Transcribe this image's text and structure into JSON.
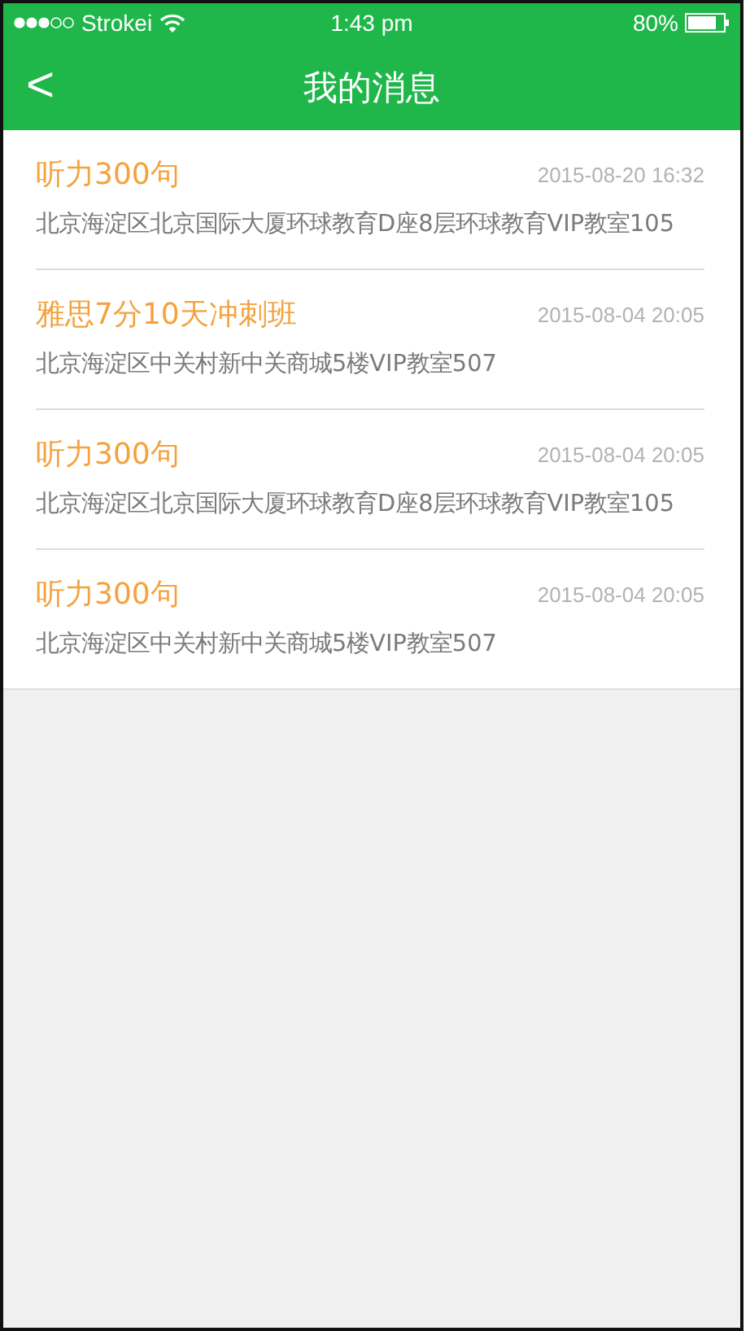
{
  "status_bar": {
    "carrier": "Strokei",
    "time": "1:43 pm",
    "battery": "80%"
  },
  "nav": {
    "back": "<",
    "title": "我的消息"
  },
  "messages": [
    {
      "title": "听力300句",
      "time": "2015-08-20 16:32",
      "address": "北京海淀区北京国际大厦环球教育D座8层环球教育VIP教室105"
    },
    {
      "title": "雅思7分10天冲刺班",
      "time": "2015-08-04 20:05",
      "address": "北京海淀区中关村新中关商城5楼VIP教室507"
    },
    {
      "title": "听力300句",
      "time": "2015-08-04 20:05",
      "address": "北京海淀区北京国际大厦环球教育D座8层环球教育VIP教室105"
    },
    {
      "title": "听力300句",
      "time": "2015-08-04 20:05",
      "address": "北京海淀区中关村新中关商城5楼VIP教室507"
    }
  ]
}
